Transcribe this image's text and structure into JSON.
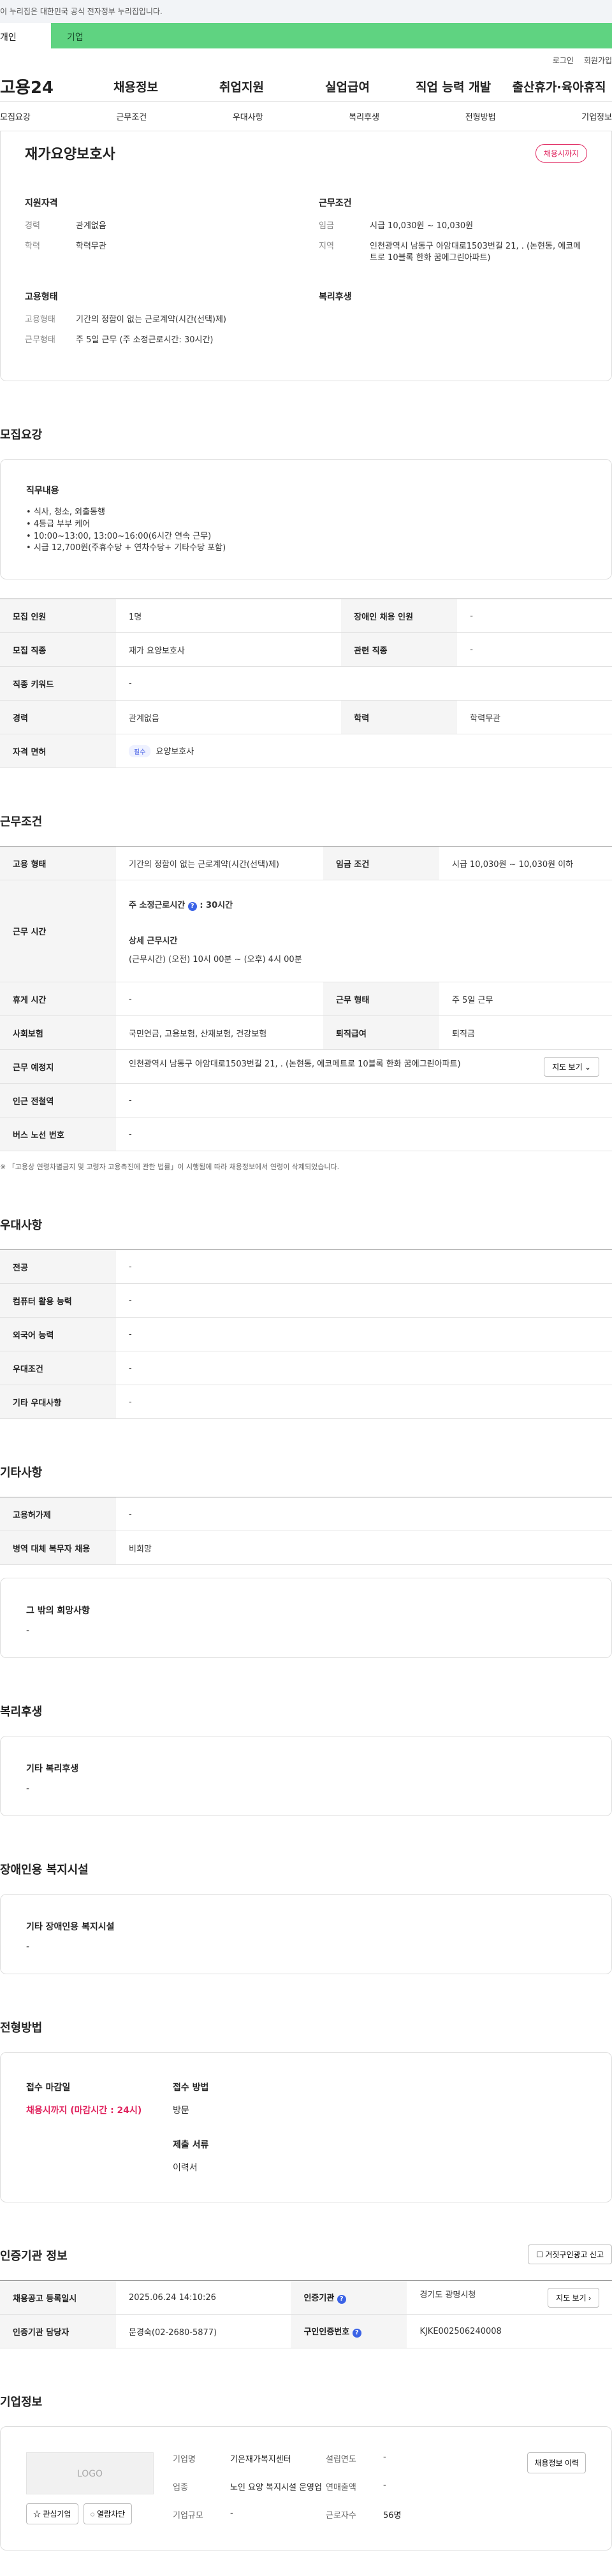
{
  "gov_bar": {
    "text": "이 누리집은 대한민국 공식 전자정부 누리집입니다."
  },
  "user_tabs": [
    "개인",
    "기업"
  ],
  "top_links": [
    "로그인",
    "회원가입"
  ],
  "logo": "고용24",
  "main_nav": [
    "채용정보",
    "취업지원",
    "실업급여",
    "직업 능력 개발",
    "출산휴가·육아휴직"
  ],
  "anchor_tabs": [
    "모집요강",
    "근무조건",
    "우대사항",
    "복리후생",
    "전형방법",
    "기업정보"
  ],
  "summary": {
    "title": "재가요양보호사",
    "badge": "채용시까지",
    "qual": {
      "heading": "지원자격",
      "rows": [
        {
          "k": "경력",
          "v": "관계없음"
        },
        {
          "k": "학력",
          "v": "학력무관"
        }
      ]
    },
    "work": {
      "heading": "근무조건",
      "rows": [
        {
          "k": "임금",
          "v": "시급 10,030원 ~ 10,030원"
        },
        {
          "k": "지역",
          "v": "인천광역시 남동구 아암대로1503번길 21, . (논현동, 에코메트로 10블록 한화 꿈에그린아파트)"
        }
      ]
    },
    "emp": {
      "heading": "고용형태",
      "rows": [
        {
          "k": "고용형태",
          "v": "기간의 정함이 없는 근로계약(시간(선택)제)"
        },
        {
          "k": "근무형태",
          "v": "주 5일 근무 (주 소정근로시간: 30시간)"
        }
      ]
    },
    "welfare": {
      "heading": "복리후생"
    }
  },
  "recruit": {
    "title": "모집요강",
    "duty_heading": "직무내용",
    "duties": [
      "식사, 청소, 외출동행",
      "4등급 부부 케어",
      "10:00~13:00, 13:00~16:00(6시간  연속 근무)",
      "시급 12,700원(주휴수당 + 연차수당+ 기타수당 포함)"
    ],
    "rows": [
      {
        "k1": "모집 인원",
        "v1": "1명",
        "k2": "장애인 채용 인원",
        "v2": "-"
      },
      {
        "k1": "모집 직종",
        "v1": "재가 요양보호사",
        "k2": "관련 직종",
        "v2": "-"
      },
      {
        "k1": "직종 키워드",
        "v1": "-"
      },
      {
        "k1": "경력",
        "v1": "관계없음",
        "k2": "학력",
        "v2": "학력무관"
      },
      {
        "k1": "자격 면허",
        "pill": "필수",
        "v1": "요양보호사"
      }
    ]
  },
  "work": {
    "title": "근무조건",
    "emp_type_k": "고용 형태",
    "emp_type_v": "기간의 정함이 없는 근로계약(시간(선택)제)",
    "wage_k": "임금 조건",
    "wage_v": "시급 10,030원 ~ 10,030원 이하",
    "hours_k": "근무 시간",
    "hours_weekly": "주 소정근로시간",
    "hours_weekly_q": "?",
    "hours_weekly_v": ": 30시간",
    "hours_detail_h": "상세 근무시간",
    "hours_detail_v": "(근무시간) (오전) 10시 00분 ~ (오후) 4시 00분",
    "rest_k": "휴게 시간",
    "rest_v": "-",
    "shift_k": "근무 형태",
    "shift_v": "주 5일 근무",
    "ins_k": "사회보험",
    "ins_v": "국민연금, 고용보험, 산재보험, 건강보험",
    "sev_k": "퇴직급여",
    "sev_v": "퇴직금",
    "place_k": "근무 예정지",
    "place_v": "인천광역시 남동구 아암대로1503번길 21, . (논현동, 에코메트로 10블록 한화 꿈에그린아파트)",
    "map_btn": "지도 보기 ⌄",
    "subway_k": "인근 전철역",
    "subway_v": "-",
    "bus_k": "버스 노선 번호",
    "bus_v": "-",
    "note": "※ 「고용상 연령차별금지 및 고령자 고용촉진에 관한 법률」이 시행됨에 따라 채용정보에서 연령이 삭제되었습니다."
  },
  "prefer": {
    "title": "우대사항",
    "rows": [
      {
        "k": "전공",
        "v": "-"
      },
      {
        "k": "컴퓨터 활용 능력",
        "v": "-"
      },
      {
        "k": "외국어 능력",
        "v": "-"
      },
      {
        "k": "우대조건",
        "v": "-"
      },
      {
        "k": "기타 우대사항",
        "v": "-"
      }
    ]
  },
  "etc": {
    "title": "기타사항",
    "rows": [
      {
        "k": "고용허가제",
        "v": "-"
      },
      {
        "k": "병역 대체 복무자 채용",
        "v": "비희망"
      }
    ],
    "other_heading": "그 밖의 희망사항",
    "other_v": "-"
  },
  "welfare": {
    "title": "복리후생",
    "heading": "기타 복리후생",
    "v": "-"
  },
  "disabled": {
    "title": "장애인용 복지시설",
    "heading": "기타 장애인용 복지시설",
    "v": "-"
  },
  "selection": {
    "title": "전형방법",
    "deadline_h": "접수 마감일",
    "deadline_v": "채용시까지 (마감시간 : 24시)",
    "method_h": "접수 방법",
    "method_v": "방문",
    "docs_h": "제출 서류",
    "docs_v": "이력서"
  },
  "cert": {
    "title": "인증기관 정보",
    "report_btn": "☐ 거짓구인광고 신고",
    "reg_k": "채용공고 등록일시",
    "reg_v": "2025.06.24 14:10:26",
    "agency_k": "인증기관",
    "agency_v": "경기도 광명시청",
    "map_btn": "지도 보기 ›",
    "mgr_k": "인증기관 담당자",
    "mgr_v": "문경숙(02-2680-5877)",
    "no_k": "구인인증번호",
    "no_v": "KJKE002506240008"
  },
  "company": {
    "title": "기업정보",
    "logo_text": "LOGO",
    "btn_interest": "☆ 관심기업",
    "btn_block": "◌ 열람차단",
    "name_k": "기업명",
    "name_v": "기은재가복지센터",
    "found_k": "설립연도",
    "found_v": "-",
    "ind_k": "업종",
    "ind_v": "노인 요양 복지시설 운영업",
    "sales_k": "연매출액",
    "sales_v": "-",
    "emp_k": "근로자수",
    "emp_v": "56명",
    "size_k": "기업규모",
    "size_v": "-",
    "btn_history": "채용정보 이력"
  }
}
